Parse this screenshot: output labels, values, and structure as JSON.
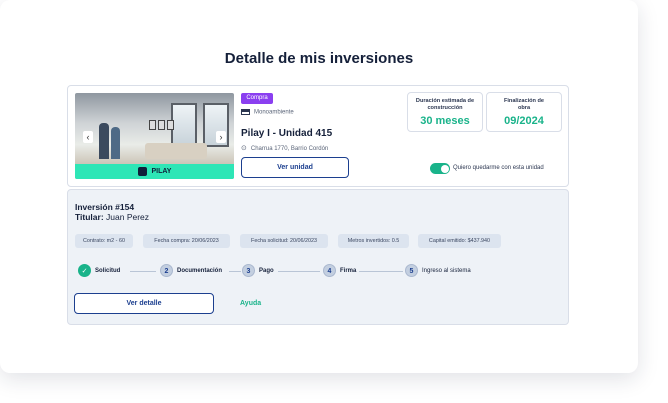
{
  "page": {
    "title": "Detalle de mis inversiones"
  },
  "property": {
    "brand": "PILAY",
    "badge": "Compra",
    "type": "Monoambiente",
    "unit": "Pilay I - Unidad 415",
    "address": "Charrua 1770, Barrio Cordón",
    "view_button": "Ver unidad",
    "stats": [
      {
        "label": "Duración estimada de construcción",
        "value": "30 meses"
      },
      {
        "label": "Finalización de obra",
        "value": "09/2024"
      }
    ],
    "toggle_label": "Quiero quedarme con esta unidad",
    "toggle_on": true
  },
  "investment": {
    "title": "Inversión #154",
    "holder_label": "Titular:",
    "holder_name": "Juan Perez",
    "chips": [
      "Contrato: m2 - 60",
      "Fecha compra: 20/06/2023",
      "Fecha solicitud: 20/06/2023",
      "Metros invertidos: 0.5",
      "Capital emitido: $437.940"
    ],
    "steps": [
      {
        "num": "✓",
        "label": "Solicitud",
        "done": true
      },
      {
        "num": "2",
        "label": "Documentación",
        "done": false
      },
      {
        "num": "3",
        "label": "Pago",
        "done": false
      },
      {
        "num": "4",
        "label": "Firma",
        "done": false
      },
      {
        "num": "5",
        "label": "Ingreso al sistema",
        "done": false
      }
    ],
    "detail_button": "Ver detalle",
    "help_link": "Ayuda"
  },
  "colors": {
    "accent": "#19b38a",
    "brand_blue": "#1c3f8f",
    "badge": "#8a3ff0"
  }
}
